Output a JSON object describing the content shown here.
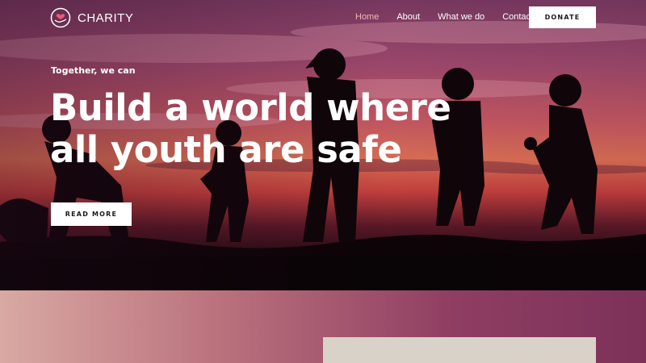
{
  "brand": {
    "name": "CHARITY",
    "icon": "heart-hand-icon"
  },
  "nav": {
    "items": [
      {
        "label": "Home",
        "active": true
      },
      {
        "label": "About",
        "active": false
      },
      {
        "label": "What we do",
        "active": false
      },
      {
        "label": "Contact",
        "active": false
      }
    ],
    "donate_label": "DONATE"
  },
  "hero": {
    "tagline": "Together, we can",
    "headline_line1": "Build a world where",
    "headline_line2": "all youth are safe",
    "cta_label": "READ MORE"
  },
  "colors": {
    "accent_active": "#f3b7b7",
    "button_bg": "#ffffff",
    "button_text": "#1b1b1b"
  }
}
